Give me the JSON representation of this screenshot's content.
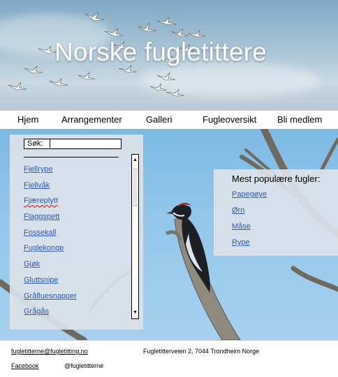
{
  "header": {
    "title": "Norske fugletittere"
  },
  "nav": {
    "items": [
      {
        "label": "Hjem"
      },
      {
        "label": "Arrangementer"
      },
      {
        "label": "Galleri"
      },
      {
        "label": "Fugleoversikt"
      },
      {
        "label": "Bli medlem"
      }
    ]
  },
  "search": {
    "label": "Søk:",
    "value": ""
  },
  "bird_list": [
    "Fjellrype",
    "Fjellvåk",
    "Fjæreplytt",
    "Flaggspett",
    "Fossekall",
    "Fuglekonge",
    "Gjøk",
    "Gluttsnipe",
    "Gråfluesnapper",
    "Grågås"
  ],
  "popular": {
    "heading": "Mest populære fugler:",
    "items": [
      "Papegøye",
      "Ørn",
      "Måse",
      "Rype"
    ]
  },
  "footer": {
    "email": "fugletitterne@fugletitting.no",
    "address": "Fugletitterveien 2, 7044 Trondheim Norge",
    "facebook_label": "Facebook",
    "handle": "@fugletitterne"
  },
  "icons": {
    "scroll_up": "scroll-up-arrow-icon",
    "scroll_down": "scroll-down-arrow-icon"
  },
  "colors": {
    "link": "#2e5bb0",
    "panel": "#dce2ea",
    "sky": "#7db9e3"
  }
}
